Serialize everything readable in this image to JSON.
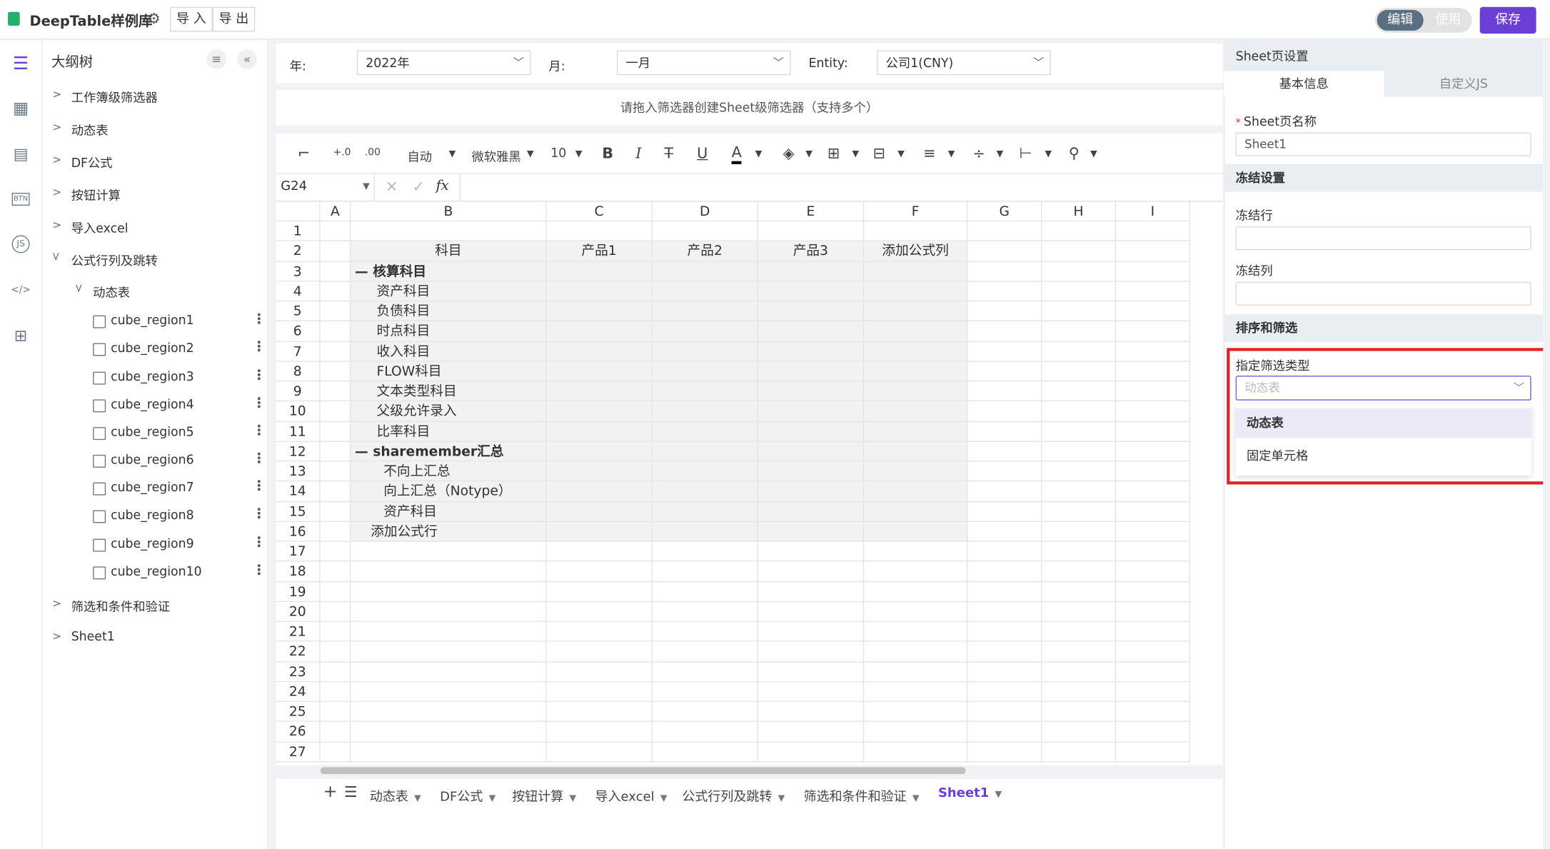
{
  "app": {
    "title": "DeepTable样例库",
    "import_label": "导 入",
    "export_label": "导 出"
  },
  "mode": {
    "edit": "编辑",
    "use": "使用"
  },
  "save_label": "保存",
  "colors": {
    "accent": "#6b3fd6",
    "highlight": "#e02020",
    "logo": "#20b26b"
  },
  "rail_icons": [
    "outline-tree-icon",
    "dashboard-grid-icon",
    "list-icon",
    "btn-icon",
    "js-icon",
    "code-icon",
    "table-tree-icon"
  ],
  "tree": {
    "title": "大纲树",
    "items": [
      {
        "label": "工作簿级筛选器"
      },
      {
        "label": "动态表"
      },
      {
        "label": "DF公式"
      },
      {
        "label": "按钮计算"
      },
      {
        "label": "导入excel"
      },
      {
        "label": "公式行列及跳转"
      },
      {
        "label": "动态表"
      },
      {
        "label": "cube_region1"
      },
      {
        "label": "cube_region2"
      },
      {
        "label": "cube_region3"
      },
      {
        "label": "cube_region4"
      },
      {
        "label": "cube_region5"
      },
      {
        "label": "cube_region6"
      },
      {
        "label": "cube_region7"
      },
      {
        "label": "cube_region8"
      },
      {
        "label": "cube_region9"
      },
      {
        "label": "cube_region10"
      },
      {
        "label": "筛选和条件和验证"
      },
      {
        "label": "Sheet1"
      }
    ]
  },
  "filters": {
    "year_label": "年:",
    "year_value": "2022年",
    "month_label": "月:",
    "month_value": "一月",
    "entity_label": "Entity:",
    "entity_value": "公司1(CNY)"
  },
  "dropzone": "请拖入筛选器创建Sheet级筛选器（支持多个）",
  "toolbar": {
    "format": "自动",
    "font": "微软雅黑",
    "size": "10",
    "bold": "B",
    "italic": "I",
    "underline": "U",
    "fontcolor": "A",
    "inc": "+.0",
    "dec": ".00"
  },
  "formula_bar": {
    "cell_ref": "G24",
    "fx": "fx"
  },
  "grid": {
    "columns": [
      "A",
      "B",
      "C",
      "D",
      "E",
      "F",
      "G",
      "H",
      "I"
    ],
    "rows": [
      "1",
      "2",
      "3",
      "4",
      "5",
      "6",
      "7",
      "8",
      "9",
      "10",
      "11",
      "12",
      "13",
      "14",
      "15",
      "16",
      "17",
      "18",
      "19",
      "20",
      "21",
      "22",
      "23",
      "24",
      "25",
      "26",
      "27"
    ],
    "headers": {
      "b2": "科目",
      "c2": "产品1",
      "d2": "产品2",
      "e2": "产品3",
      "f2": "添加公式列"
    },
    "b_values": [
      "",
      "",
      "— 核算科目",
      "资产科目",
      "负债科目",
      "时点科目",
      "收入科目",
      "FLOW科目",
      "文本类型科目",
      "父级允许录入",
      "比率科目",
      "—  sharemember汇总",
      "不向上汇总",
      "向上汇总（Notype）",
      "资产科目",
      "添加公式行"
    ]
  },
  "sheet_tabs": [
    {
      "label": "动态表"
    },
    {
      "label": "DF公式"
    },
    {
      "label": "按钮计算"
    },
    {
      "label": "导入excel"
    },
    {
      "label": "公式行列及跳转"
    },
    {
      "label": "筛选和条件和验证"
    },
    {
      "label": "Sheet1"
    }
  ],
  "panel": {
    "title": "Sheet页设置",
    "tab_basic": "基本信息",
    "tab_js": "自定义JS",
    "sheet_name_label": "Sheet页名称",
    "sheet_name_value": "Sheet1",
    "freeze_section": "冻结设置",
    "freeze_row_label": "冻结行",
    "freeze_col_label": "冻结列",
    "sort_section": "排序和筛选",
    "filter_type_label": "指定筛选类型",
    "filter_type_placeholder": "动态表",
    "options": [
      "动态表",
      "固定单元格"
    ]
  }
}
